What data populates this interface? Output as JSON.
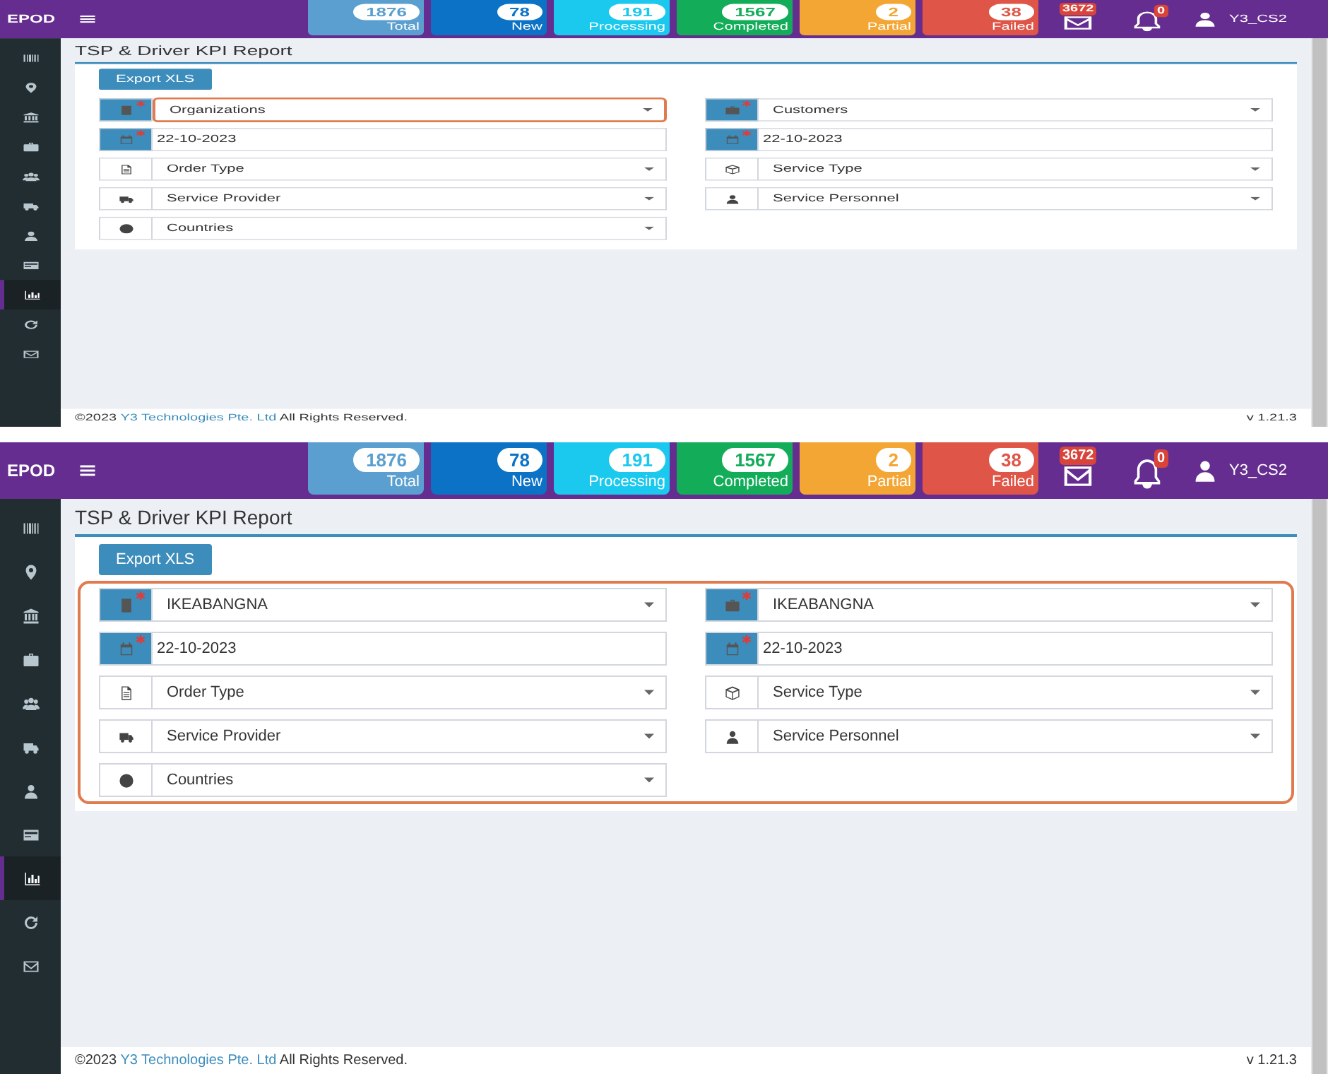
{
  "screens": [
    {
      "form_highlighted": false,
      "header": {
        "logo": "EPOD",
        "stats": [
          {
            "count": "1876",
            "label": "Total",
            "color": "#5a9fcf"
          },
          {
            "count": "78",
            "label": "New",
            "color": "#0b72c6"
          },
          {
            "count": "191",
            "label": "Processing",
            "color": "#1bc9ee"
          },
          {
            "count": "1567",
            "label": "Completed",
            "color": "#13ad5a"
          },
          {
            "count": "2",
            "label": "Partial",
            "color": "#f4a635"
          },
          {
            "count": "38",
            "label": "Failed",
            "color": "#df5648"
          }
        ],
        "mail_count": "3672",
        "notification_count": "0",
        "user": "Y3_CS2"
      },
      "sidebar": [
        {
          "selected": false
        },
        {
          "selected": false
        },
        {
          "selected": false
        },
        {
          "selected": false
        },
        {
          "selected": false
        },
        {
          "selected": false
        },
        {
          "selected": false
        },
        {
          "selected": false
        },
        {
          "selected": true
        },
        {
          "selected": false
        },
        {
          "selected": false
        }
      ],
      "title": "TSP & Driver KPI Report",
      "export_button": "Export XLS",
      "fields": [
        {
          "kind": "select",
          "required": true,
          "value": "Organizations",
          "highlighted": true
        },
        {
          "kind": "select",
          "required": true,
          "value": "Customers",
          "highlighted": false
        },
        {
          "kind": "date",
          "required": true,
          "value": "22-10-2023",
          "highlighted": false
        },
        {
          "kind": "date",
          "required": true,
          "value": "22-10-2023",
          "highlighted": false
        },
        {
          "kind": "select",
          "required": false,
          "value": "Order Type",
          "highlighted": false
        },
        {
          "kind": "select",
          "required": false,
          "value": "Service Type",
          "highlighted": false
        },
        {
          "kind": "select",
          "required": false,
          "value": "Service Provider",
          "highlighted": false
        },
        {
          "kind": "select",
          "required": false,
          "value": "Service Personnel",
          "highlighted": false
        },
        {
          "kind": "select",
          "required": false,
          "value": "Countries",
          "highlighted": false
        }
      ],
      "footer": {
        "copyright": "©2023",
        "company": "Y3 Technologies Pte. Ltd",
        "rights": "All Rights Reserved.",
        "version": "v 1.21.3"
      }
    },
    {
      "form_highlighted": true,
      "header": {
        "logo": "EPOD",
        "stats": [
          {
            "count": "1876",
            "label": "Total",
            "color": "#5a9fcf"
          },
          {
            "count": "78",
            "label": "New",
            "color": "#0b72c6"
          },
          {
            "count": "191",
            "label": "Processing",
            "color": "#1bc9ee"
          },
          {
            "count": "1567",
            "label": "Completed",
            "color": "#13ad5a"
          },
          {
            "count": "2",
            "label": "Partial",
            "color": "#f4a635"
          },
          {
            "count": "38",
            "label": "Failed",
            "color": "#df5648"
          }
        ],
        "mail_count": "3672",
        "notification_count": "0",
        "user": "Y3_CS2"
      },
      "sidebar": [
        {
          "selected": false
        },
        {
          "selected": false
        },
        {
          "selected": false
        },
        {
          "selected": false
        },
        {
          "selected": false
        },
        {
          "selected": false
        },
        {
          "selected": false
        },
        {
          "selected": false
        },
        {
          "selected": true
        },
        {
          "selected": false
        },
        {
          "selected": false
        }
      ],
      "title": "TSP & Driver KPI Report",
      "export_button": "Export XLS",
      "fields": [
        {
          "kind": "select",
          "required": true,
          "value": "IKEABANGNA",
          "highlighted": false
        },
        {
          "kind": "select",
          "required": true,
          "value": "IKEABANGNA",
          "highlighted": false
        },
        {
          "kind": "date",
          "required": true,
          "value": "22-10-2023",
          "highlighted": false
        },
        {
          "kind": "date",
          "required": true,
          "value": "22-10-2023",
          "highlighted": false
        },
        {
          "kind": "select",
          "required": false,
          "value": "Order Type",
          "highlighted": false
        },
        {
          "kind": "select",
          "required": false,
          "value": "Service Type",
          "highlighted": false
        },
        {
          "kind": "select",
          "required": false,
          "value": "Service Provider",
          "highlighted": false
        },
        {
          "kind": "select",
          "required": false,
          "value": "Service Personnel",
          "highlighted": false
        },
        {
          "kind": "select",
          "required": false,
          "value": "Countries",
          "highlighted": false
        }
      ],
      "footer": {
        "copyright": "©2023",
        "company": "Y3 Technologies Pte. Ltd",
        "rights": "All Rights Reserved.",
        "version": "v 1.21.3"
      }
    }
  ]
}
